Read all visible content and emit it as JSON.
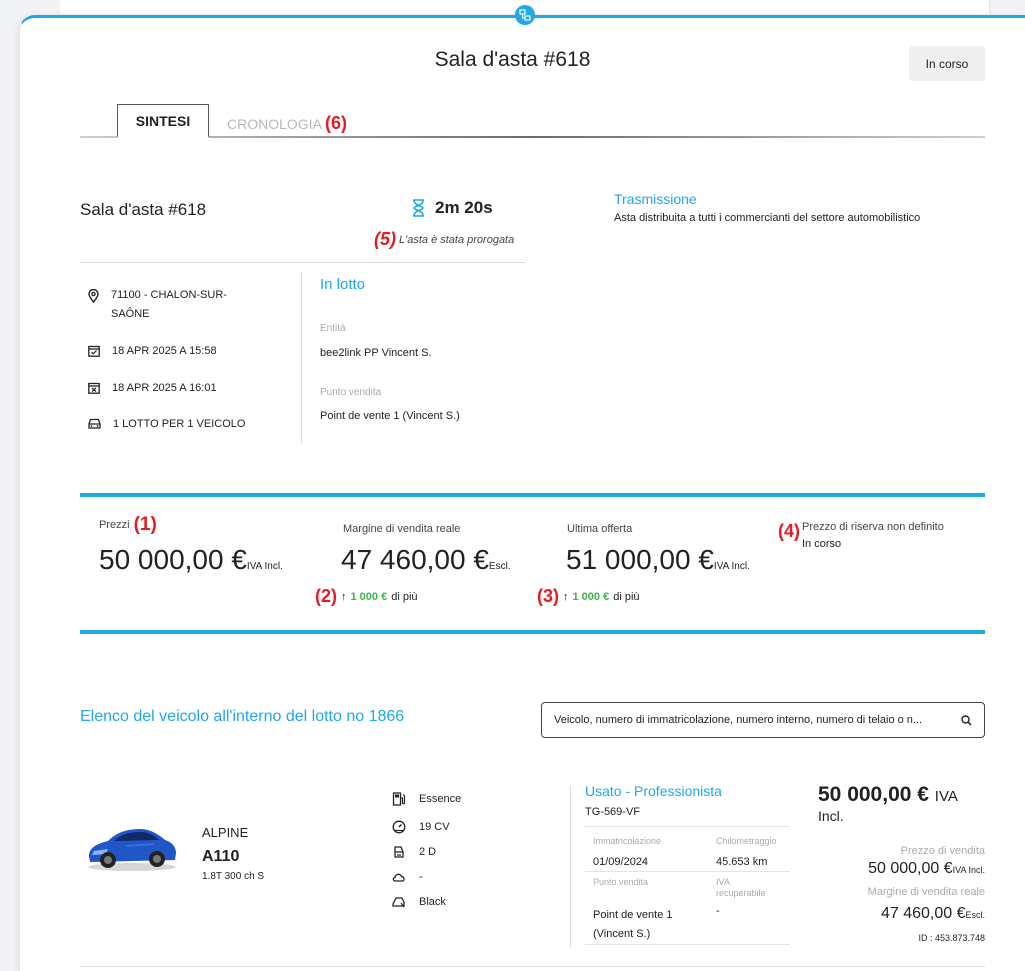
{
  "header": {
    "title": "Sala d'asta #618",
    "status": "In corso"
  },
  "tabs": {
    "summary": "SINTESI",
    "history": "CRONOLOGIA"
  },
  "markers": {
    "m1": "(1)",
    "m2": "(2)",
    "m3": "(3)",
    "m4": "(4)",
    "m5": "(5)",
    "m6": "(6)"
  },
  "summary": {
    "room_name": "Sala d'asta #618",
    "timer": "2m 20s",
    "extension_note": "L'asta è stata prorogata",
    "transmission_title": "Trasmissione",
    "transmission_desc": "Asta distribuita a tutti i commercianti del settore automobilistico",
    "location_line1": "71100 - CHALON-SUR-",
    "location_line2": "SAÔNE",
    "start_date": "18 APR 2025 A 15:58",
    "end_date": "18 APR 2025 A 16:01",
    "lot_summary": "1 LOTTO PER 1 VEICOLO",
    "lot_title": "In lotto",
    "entity_label": "Entità",
    "entity_value": "bee2link PP Vincent S.",
    "pos_label": "Punto vendita",
    "pos_value": "Point de vente 1 (Vincent S.)"
  },
  "prices": {
    "price_label": "Prezzi",
    "price_value": "50 000,00 €",
    "price_suffix": "IVA Incl.",
    "margin_label": "Margine di vendita reale",
    "margin_value": "47 460,00 €",
    "margin_suffix": "Escl.",
    "margin_delta": "1 000 €",
    "delta_suffix": "di più",
    "offer_label": "Ultima offerta",
    "offer_value": "51 000,00 €",
    "offer_suffix": "IVA Incl.",
    "offer_delta": "1 000 €",
    "reserve_label": "Prezzo di riserva non definito",
    "reserve_status": "In corso"
  },
  "vehicles": {
    "list_title": "Elenco del veicolo all'interno del lotto no 1866",
    "search_placeholder": "Veicolo, numero di immatricolazione, numero interno, numero di telaio o n...",
    "item": {
      "make": "ALPINE",
      "model": "A110",
      "version": "1.8T 300 ch S",
      "fuel": "Essence",
      "power": "19 CV",
      "doors": "2 D",
      "body": "-",
      "color": "Black",
      "category": "Usato - Professionista",
      "plate": "TG-569-VF",
      "reg_label": "Immatricolazione",
      "reg_value": "01/09/2024",
      "km_label": "Chilometraggio",
      "km_value": "45.653 km",
      "pos_label": "Punto vendita",
      "pos_value_line1": "Point de vente 1",
      "pos_value_line2": "(Vincent S.)",
      "vat_label_line1": "IVA",
      "vat_label_line2": "recuperabile",
      "vat_value": "-",
      "price_big": "50 000,00 €",
      "price_big_suffix": "IVA",
      "price_big_incl": "Incl.",
      "sale_price_label": "Prezzo di vendita",
      "sale_price_value": "50 000,00 €",
      "sale_price_suffix": "IVA Incl.",
      "real_margin_label": "Margine di vendita reale",
      "real_margin_value": "47 460,00 €",
      "real_margin_suffix": "Escl.",
      "id": "ID : 453.873.748"
    }
  }
}
